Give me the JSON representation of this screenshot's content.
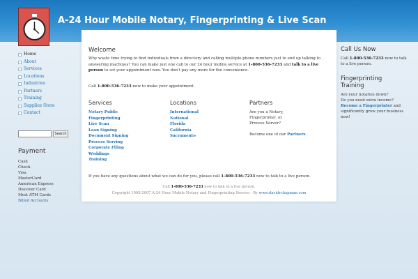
{
  "header": {
    "site_title": "A-24 Hour Mobile Notary, Fingerprinting & Live Scan",
    "logo_icon": "stopwatch-icon"
  },
  "nav": {
    "items": [
      {
        "label": "Home",
        "active": true
      },
      {
        "label": "About"
      },
      {
        "label": "Services"
      },
      {
        "label": "Locations"
      },
      {
        "label": "Industries"
      },
      {
        "label": "Partners"
      },
      {
        "label": "Training"
      },
      {
        "label": "Supplies Store"
      },
      {
        "label": "Contact"
      }
    ]
  },
  "search": {
    "value": "",
    "button_label": "Search"
  },
  "payment": {
    "title": "Payment",
    "items": [
      "Cash",
      "Check",
      "Visa",
      "MasterCard",
      "American Express",
      "Discover Card",
      "Most ATM Cards",
      "Billed Accounts"
    ]
  },
  "main": {
    "welcome_title": "Welcome",
    "intro_1": "Why waste time trying to find individuals from a directory and calling multiple phone numbers just to end up talking to answering machines? You can make just one call to our 24 hour mobile service at ",
    "intro_phone": "1-800-536-7233",
    "intro_2": " and ",
    "intro_live": "talk to a live person",
    "intro_3": " to set your appointment now. You don't pay any more for the convenience.",
    "call_1": "Call ",
    "call_phone": "1-800-536-7233",
    "call_2": " now to make your appointment.",
    "services": {
      "title": "Services",
      "items": [
        "Notary Public",
        "Fingerprinting",
        "Live Scan",
        "Loan Signing",
        "Document Signing",
        "Process Serving",
        "Corporate Filing",
        "Weddings",
        "Training"
      ]
    },
    "locations": {
      "title": "Locations",
      "items": [
        "International",
        "National",
        "Florida",
        "California",
        "Sacramento"
      ]
    },
    "partners": {
      "title": "Partners",
      "text_1": "Are you a Notary,",
      "text_2": "Fingerprinter, or",
      "text_3": "Process Server?",
      "become_1": "Become one of our ",
      "become_link": "Partners",
      "become_2": "."
    },
    "questions_1": "If you have any questions about what we can do for you, please call ",
    "questions_phone": "1-800-536-7233",
    "questions_2": " now to talk to a live person."
  },
  "footer": {
    "line1_1": "Call ",
    "line1_phone": "1-800-536-7233",
    "line1_2": " now to talk to a live person.",
    "line2_text": "Copyright 1998-2007 A-24 Hour Mobile Notary and Fingerprinting Service - By ",
    "line2_link": "www.davidrchapman.com"
  },
  "right": {
    "call_title": "Call Us Now",
    "call_1": "Call ",
    "call_phone": "1-800-536-7233",
    "call_2": " now to talk to a live person.",
    "fp_title_1": "Fingerprinting",
    "fp_title_2": "Training",
    "fp_q1": "Are your notaries down?",
    "fp_q2": "Do you need extra income?",
    "fp_link": "Become a Fingerprinter",
    "fp_text": " and significantly grow your business now!"
  },
  "colors": {
    "header_blue": "#1b78bf",
    "link_blue": "#1f6fb0",
    "logo_red": "#d9534f"
  }
}
